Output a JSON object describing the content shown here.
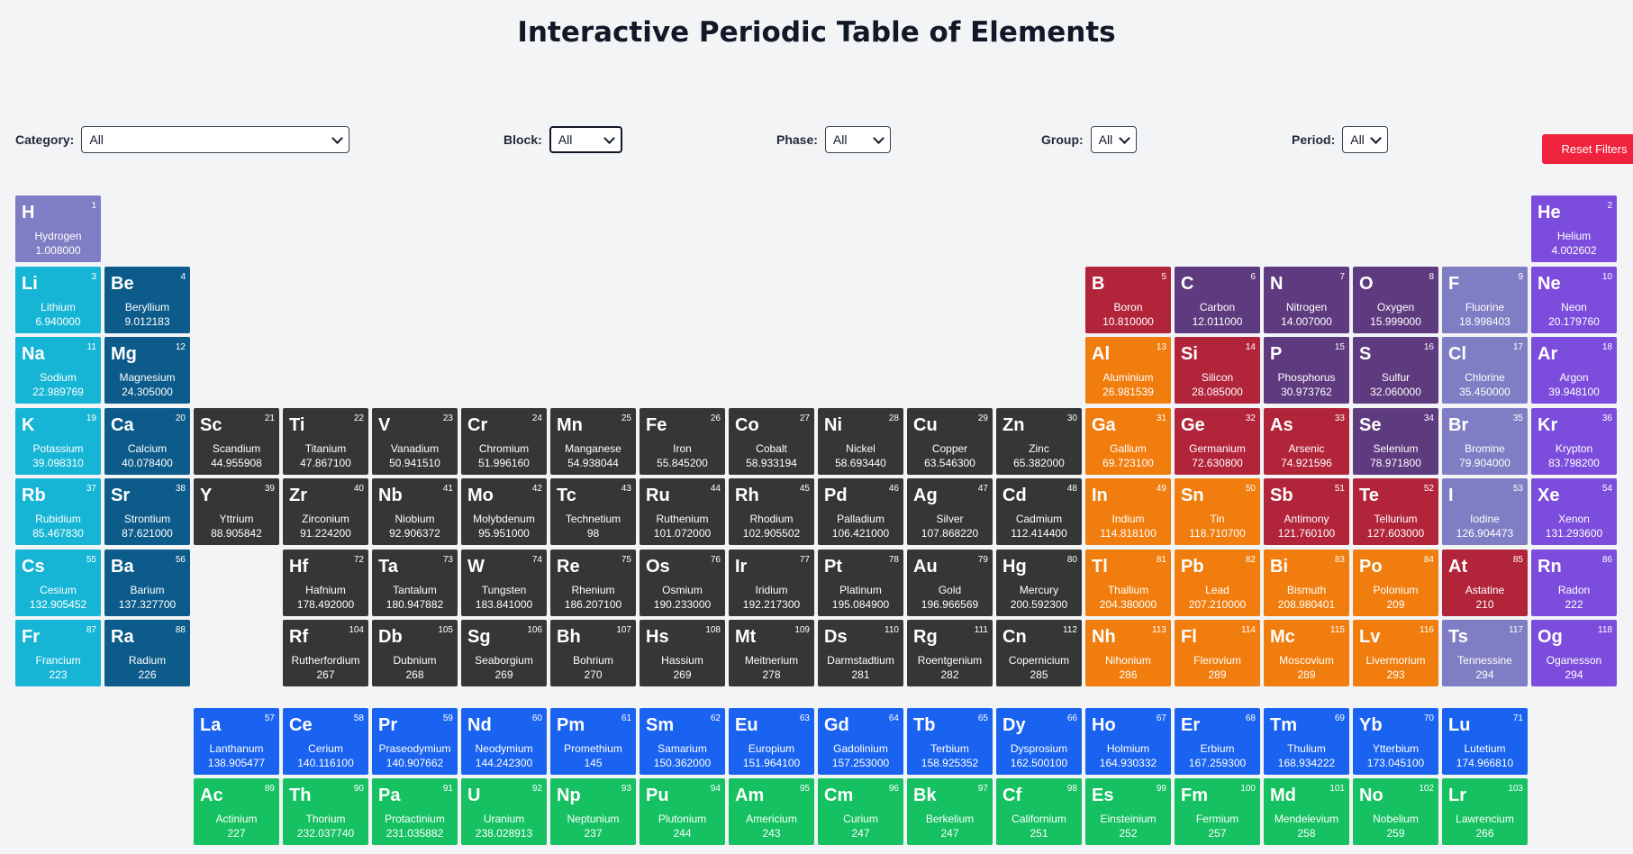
{
  "page_title": "Interactive Periodic Table of Elements",
  "filters": {
    "category": {
      "label": "Category:",
      "value": "All"
    },
    "block": {
      "label": "Block:",
      "value": "All"
    },
    "phase": {
      "label": "Phase:",
      "value": "All"
    },
    "group": {
      "label": "Group:",
      "value": "All"
    },
    "period": {
      "label": "Period:",
      "value": "All"
    },
    "reset_label": "Reset Filters"
  },
  "colors": {
    "nonmetal": "#5e3a7e",
    "noble-gas": "#7c4ddc",
    "alkali-metal": "#16b5d6",
    "alkaline-earth": "#0c5b8a",
    "metalloid": "#b2243a",
    "halogen": "#7f7ec4",
    "transition-metal": "#353638",
    "post-transition": "#f07d0d",
    "lanthanide": "#1a62f0",
    "actinide": "#15c160",
    "reset": "#ef233c"
  },
  "elements": [
    {
      "n": 1,
      "s": "H",
      "name": "Hydrogen",
      "mass": "1.008000",
      "cat": "halogen",
      "p": 1,
      "g": 1
    },
    {
      "n": 2,
      "s": "He",
      "name": "Helium",
      "mass": "4.002602",
      "cat": "noble-gas",
      "p": 1,
      "g": 18
    },
    {
      "n": 3,
      "s": "Li",
      "name": "Lithium",
      "mass": "6.940000",
      "cat": "alkali-metal",
      "p": 2,
      "g": 1
    },
    {
      "n": 4,
      "s": "Be",
      "name": "Beryllium",
      "mass": "9.012183",
      "cat": "alkaline-earth",
      "p": 2,
      "g": 2
    },
    {
      "n": 5,
      "s": "B",
      "name": "Boron",
      "mass": "10.810000",
      "cat": "metalloid",
      "p": 2,
      "g": 13
    },
    {
      "n": 6,
      "s": "C",
      "name": "Carbon",
      "mass": "12.011000",
      "cat": "nonmetal",
      "p": 2,
      "g": 14
    },
    {
      "n": 7,
      "s": "N",
      "name": "Nitrogen",
      "mass": "14.007000",
      "cat": "nonmetal",
      "p": 2,
      "g": 15
    },
    {
      "n": 8,
      "s": "O",
      "name": "Oxygen",
      "mass": "15.999000",
      "cat": "nonmetal",
      "p": 2,
      "g": 16
    },
    {
      "n": 9,
      "s": "F",
      "name": "Fluorine",
      "mass": "18.998403",
      "cat": "halogen",
      "p": 2,
      "g": 17
    },
    {
      "n": 10,
      "s": "Ne",
      "name": "Neon",
      "mass": "20.179760",
      "cat": "noble-gas",
      "p": 2,
      "g": 18
    },
    {
      "n": 11,
      "s": "Na",
      "name": "Sodium",
      "mass": "22.989769",
      "cat": "alkali-metal",
      "p": 3,
      "g": 1
    },
    {
      "n": 12,
      "s": "Mg",
      "name": "Magnesium",
      "mass": "24.305000",
      "cat": "alkaline-earth",
      "p": 3,
      "g": 2
    },
    {
      "n": 13,
      "s": "Al",
      "name": "Aluminium",
      "mass": "26.981539",
      "cat": "post-transition",
      "p": 3,
      "g": 13
    },
    {
      "n": 14,
      "s": "Si",
      "name": "Silicon",
      "mass": "28.085000",
      "cat": "metalloid",
      "p": 3,
      "g": 14
    },
    {
      "n": 15,
      "s": "P",
      "name": "Phosphorus",
      "mass": "30.973762",
      "cat": "nonmetal",
      "p": 3,
      "g": 15
    },
    {
      "n": 16,
      "s": "S",
      "name": "Sulfur",
      "mass": "32.060000",
      "cat": "nonmetal",
      "p": 3,
      "g": 16
    },
    {
      "n": 17,
      "s": "Cl",
      "name": "Chlorine",
      "mass": "35.450000",
      "cat": "halogen",
      "p": 3,
      "g": 17
    },
    {
      "n": 18,
      "s": "Ar",
      "name": "Argon",
      "mass": "39.948100",
      "cat": "noble-gas",
      "p": 3,
      "g": 18
    },
    {
      "n": 19,
      "s": "K",
      "name": "Potassium",
      "mass": "39.098310",
      "cat": "alkali-metal",
      "p": 4,
      "g": 1
    },
    {
      "n": 20,
      "s": "Ca",
      "name": "Calcium",
      "mass": "40.078400",
      "cat": "alkaline-earth",
      "p": 4,
      "g": 2
    },
    {
      "n": 21,
      "s": "Sc",
      "name": "Scandium",
      "mass": "44.955908",
      "cat": "transition-metal",
      "p": 4,
      "g": 3
    },
    {
      "n": 22,
      "s": "Ti",
      "name": "Titanium",
      "mass": "47.867100",
      "cat": "transition-metal",
      "p": 4,
      "g": 4
    },
    {
      "n": 23,
      "s": "V",
      "name": "Vanadium",
      "mass": "50.941510",
      "cat": "transition-metal",
      "p": 4,
      "g": 5
    },
    {
      "n": 24,
      "s": "Cr",
      "name": "Chromium",
      "mass": "51.996160",
      "cat": "transition-metal",
      "p": 4,
      "g": 6
    },
    {
      "n": 25,
      "s": "Mn",
      "name": "Manganese",
      "mass": "54.938044",
      "cat": "transition-metal",
      "p": 4,
      "g": 7
    },
    {
      "n": 26,
      "s": "Fe",
      "name": "Iron",
      "mass": "55.845200",
      "cat": "transition-metal",
      "p": 4,
      "g": 8
    },
    {
      "n": 27,
      "s": "Co",
      "name": "Cobalt",
      "mass": "58.933194",
      "cat": "transition-metal",
      "p": 4,
      "g": 9
    },
    {
      "n": 28,
      "s": "Ni",
      "name": "Nickel",
      "mass": "58.693440",
      "cat": "transition-metal",
      "p": 4,
      "g": 10
    },
    {
      "n": 29,
      "s": "Cu",
      "name": "Copper",
      "mass": "63.546300",
      "cat": "transition-metal",
      "p": 4,
      "g": 11
    },
    {
      "n": 30,
      "s": "Zn",
      "name": "Zinc",
      "mass": "65.382000",
      "cat": "transition-metal",
      "p": 4,
      "g": 12
    },
    {
      "n": 31,
      "s": "Ga",
      "name": "Gallium",
      "mass": "69.723100",
      "cat": "post-transition",
      "p": 4,
      "g": 13
    },
    {
      "n": 32,
      "s": "Ge",
      "name": "Germanium",
      "mass": "72.630800",
      "cat": "metalloid",
      "p": 4,
      "g": 14
    },
    {
      "n": 33,
      "s": "As",
      "name": "Arsenic",
      "mass": "74.921596",
      "cat": "metalloid",
      "p": 4,
      "g": 15
    },
    {
      "n": 34,
      "s": "Se",
      "name": "Selenium",
      "mass": "78.971800",
      "cat": "nonmetal",
      "p": 4,
      "g": 16
    },
    {
      "n": 35,
      "s": "Br",
      "name": "Bromine",
      "mass": "79.904000",
      "cat": "halogen",
      "p": 4,
      "g": 17
    },
    {
      "n": 36,
      "s": "Kr",
      "name": "Krypton",
      "mass": "83.798200",
      "cat": "noble-gas",
      "p": 4,
      "g": 18
    },
    {
      "n": 37,
      "s": "Rb",
      "name": "Rubidium",
      "mass": "85.467830",
      "cat": "alkali-metal",
      "p": 5,
      "g": 1
    },
    {
      "n": 38,
      "s": "Sr",
      "name": "Strontium",
      "mass": "87.621000",
      "cat": "alkaline-earth",
      "p": 5,
      "g": 2
    },
    {
      "n": 39,
      "s": "Y",
      "name": "Yttrium",
      "mass": "88.905842",
      "cat": "transition-metal",
      "p": 5,
      "g": 3
    },
    {
      "n": 40,
      "s": "Zr",
      "name": "Zirconium",
      "mass": "91.224200",
      "cat": "transition-metal",
      "p": 5,
      "g": 4
    },
    {
      "n": 41,
      "s": "Nb",
      "name": "Niobium",
      "mass": "92.906372",
      "cat": "transition-metal",
      "p": 5,
      "g": 5
    },
    {
      "n": 42,
      "s": "Mo",
      "name": "Molybdenum",
      "mass": "95.951000",
      "cat": "transition-metal",
      "p": 5,
      "g": 6
    },
    {
      "n": 43,
      "s": "Tc",
      "name": "Technetium",
      "mass": "98",
      "cat": "transition-metal",
      "p": 5,
      "g": 7
    },
    {
      "n": 44,
      "s": "Ru",
      "name": "Ruthenium",
      "mass": "101.072000",
      "cat": "transition-metal",
      "p": 5,
      "g": 8
    },
    {
      "n": 45,
      "s": "Rh",
      "name": "Rhodium",
      "mass": "102.905502",
      "cat": "transition-metal",
      "p": 5,
      "g": 9
    },
    {
      "n": 46,
      "s": "Pd",
      "name": "Palladium",
      "mass": "106.421000",
      "cat": "transition-metal",
      "p": 5,
      "g": 10
    },
    {
      "n": 47,
      "s": "Ag",
      "name": "Silver",
      "mass": "107.868220",
      "cat": "transition-metal",
      "p": 5,
      "g": 11
    },
    {
      "n": 48,
      "s": "Cd",
      "name": "Cadmium",
      "mass": "112.414400",
      "cat": "transition-metal",
      "p": 5,
      "g": 12
    },
    {
      "n": 49,
      "s": "In",
      "name": "Indium",
      "mass": "114.818100",
      "cat": "post-transition",
      "p": 5,
      "g": 13
    },
    {
      "n": 50,
      "s": "Sn",
      "name": "Tin",
      "mass": "118.710700",
      "cat": "post-transition",
      "p": 5,
      "g": 14
    },
    {
      "n": 51,
      "s": "Sb",
      "name": "Antimony",
      "mass": "121.760100",
      "cat": "metalloid",
      "p": 5,
      "g": 15
    },
    {
      "n": 52,
      "s": "Te",
      "name": "Tellurium",
      "mass": "127.603000",
      "cat": "metalloid",
      "p": 5,
      "g": 16
    },
    {
      "n": 53,
      "s": "I",
      "name": "Iodine",
      "mass": "126.904473",
      "cat": "halogen",
      "p": 5,
      "g": 17
    },
    {
      "n": 54,
      "s": "Xe",
      "name": "Xenon",
      "mass": "131.293600",
      "cat": "noble-gas",
      "p": 5,
      "g": 18
    },
    {
      "n": 55,
      "s": "Cs",
      "name": "Cesium",
      "mass": "132.905452",
      "cat": "alkali-metal",
      "p": 6,
      "g": 1
    },
    {
      "n": 56,
      "s": "Ba",
      "name": "Barium",
      "mass": "137.327700",
      "cat": "alkaline-earth",
      "p": 6,
      "g": 2
    },
    {
      "n": 72,
      "s": "Hf",
      "name": "Hafnium",
      "mass": "178.492000",
      "cat": "transition-metal",
      "p": 6,
      "g": 4
    },
    {
      "n": 73,
      "s": "Ta",
      "name": "Tantalum",
      "mass": "180.947882",
      "cat": "transition-metal",
      "p": 6,
      "g": 5
    },
    {
      "n": 74,
      "s": "W",
      "name": "Tungsten",
      "mass": "183.841000",
      "cat": "transition-metal",
      "p": 6,
      "g": 6
    },
    {
      "n": 75,
      "s": "Re",
      "name": "Rhenium",
      "mass": "186.207100",
      "cat": "transition-metal",
      "p": 6,
      "g": 7
    },
    {
      "n": 76,
      "s": "Os",
      "name": "Osmium",
      "mass": "190.233000",
      "cat": "transition-metal",
      "p": 6,
      "g": 8
    },
    {
      "n": 77,
      "s": "Ir",
      "name": "Iridium",
      "mass": "192.217300",
      "cat": "transition-metal",
      "p": 6,
      "g": 9
    },
    {
      "n": 78,
      "s": "Pt",
      "name": "Platinum",
      "mass": "195.084900",
      "cat": "transition-metal",
      "p": 6,
      "g": 10
    },
    {
      "n": 79,
      "s": "Au",
      "name": "Gold",
      "mass": "196.966569",
      "cat": "transition-metal",
      "p": 6,
      "g": 11
    },
    {
      "n": 80,
      "s": "Hg",
      "name": "Mercury",
      "mass": "200.592300",
      "cat": "transition-metal",
      "p": 6,
      "g": 12
    },
    {
      "n": 81,
      "s": "Tl",
      "name": "Thallium",
      "mass": "204.380000",
      "cat": "post-transition",
      "p": 6,
      "g": 13
    },
    {
      "n": 82,
      "s": "Pb",
      "name": "Lead",
      "mass": "207.210000",
      "cat": "post-transition",
      "p": 6,
      "g": 14
    },
    {
      "n": 83,
      "s": "Bi",
      "name": "Bismuth",
      "mass": "208.980401",
      "cat": "post-transition",
      "p": 6,
      "g": 15
    },
    {
      "n": 84,
      "s": "Po",
      "name": "Polonium",
      "mass": "209",
      "cat": "post-transition",
      "p": 6,
      "g": 16
    },
    {
      "n": 85,
      "s": "At",
      "name": "Astatine",
      "mass": "210",
      "cat": "metalloid",
      "p": 6,
      "g": 17
    },
    {
      "n": 86,
      "s": "Rn",
      "name": "Radon",
      "mass": "222",
      "cat": "noble-gas",
      "p": 6,
      "g": 18
    },
    {
      "n": 87,
      "s": "Fr",
      "name": "Francium",
      "mass": "223",
      "cat": "alkali-metal",
      "p": 7,
      "g": 1
    },
    {
      "n": 88,
      "s": "Ra",
      "name": "Radium",
      "mass": "226",
      "cat": "alkaline-earth",
      "p": 7,
      "g": 2
    },
    {
      "n": 104,
      "s": "Rf",
      "name": "Rutherfordium",
      "mass": "267",
      "cat": "transition-metal",
      "p": 7,
      "g": 4
    },
    {
      "n": 105,
      "s": "Db",
      "name": "Dubnium",
      "mass": "268",
      "cat": "transition-metal",
      "p": 7,
      "g": 5
    },
    {
      "n": 106,
      "s": "Sg",
      "name": "Seaborgium",
      "mass": "269",
      "cat": "transition-metal",
      "p": 7,
      "g": 6
    },
    {
      "n": 107,
      "s": "Bh",
      "name": "Bohrium",
      "mass": "270",
      "cat": "transition-metal",
      "p": 7,
      "g": 7
    },
    {
      "n": 108,
      "s": "Hs",
      "name": "Hassium",
      "mass": "269",
      "cat": "transition-metal",
      "p": 7,
      "g": 8
    },
    {
      "n": 109,
      "s": "Mt",
      "name": "Meitnerium",
      "mass": "278",
      "cat": "transition-metal",
      "p": 7,
      "g": 9
    },
    {
      "n": 110,
      "s": "Ds",
      "name": "Darmstadtium",
      "mass": "281",
      "cat": "transition-metal",
      "p": 7,
      "g": 10
    },
    {
      "n": 111,
      "s": "Rg",
      "name": "Roentgenium",
      "mass": "282",
      "cat": "transition-metal",
      "p": 7,
      "g": 11
    },
    {
      "n": 112,
      "s": "Cn",
      "name": "Copernicium",
      "mass": "285",
      "cat": "transition-metal",
      "p": 7,
      "g": 12
    },
    {
      "n": 113,
      "s": "Nh",
      "name": "Nihonium",
      "mass": "286",
      "cat": "post-transition",
      "p": 7,
      "g": 13
    },
    {
      "n": 114,
      "s": "Fl",
      "name": "Flerovium",
      "mass": "289",
      "cat": "post-transition",
      "p": 7,
      "g": 14
    },
    {
      "n": 115,
      "s": "Mc",
      "name": "Moscovium",
      "mass": "289",
      "cat": "post-transition",
      "p": 7,
      "g": 15
    },
    {
      "n": 116,
      "s": "Lv",
      "name": "Livermorium",
      "mass": "293",
      "cat": "post-transition",
      "p": 7,
      "g": 16
    },
    {
      "n": 117,
      "s": "Ts",
      "name": "Tennessine",
      "mass": "294",
      "cat": "halogen",
      "p": 7,
      "g": 17
    },
    {
      "n": 118,
      "s": "Og",
      "name": "Oganesson",
      "mass": "294",
      "cat": "noble-gas",
      "p": 7,
      "g": 18
    },
    {
      "n": 57,
      "s": "La",
      "name": "Lanthanum",
      "mass": "138.905477",
      "cat": "lanthanide",
      "p": 6,
      "g": "La"
    },
    {
      "n": 58,
      "s": "Ce",
      "name": "Cerium",
      "mass": "140.116100",
      "cat": "lanthanide",
      "p": 6,
      "g": "La"
    },
    {
      "n": 59,
      "s": "Pr",
      "name": "Praseodymium",
      "mass": "140.907662",
      "cat": "lanthanide",
      "p": 6,
      "g": "La"
    },
    {
      "n": 60,
      "s": "Nd",
      "name": "Neodymium",
      "mass": "144.242300",
      "cat": "lanthanide",
      "p": 6,
      "g": "La"
    },
    {
      "n": 61,
      "s": "Pm",
      "name": "Promethium",
      "mass": "145",
      "cat": "lanthanide",
      "p": 6,
      "g": "La"
    },
    {
      "n": 62,
      "s": "Sm",
      "name": "Samarium",
      "mass": "150.362000",
      "cat": "lanthanide",
      "p": 6,
      "g": "La"
    },
    {
      "n": 63,
      "s": "Eu",
      "name": "Europium",
      "mass": "151.964100",
      "cat": "lanthanide",
      "p": 6,
      "g": "La"
    },
    {
      "n": 64,
      "s": "Gd",
      "name": "Gadolinium",
      "mass": "157.253000",
      "cat": "lanthanide",
      "p": 6,
      "g": "La"
    },
    {
      "n": 65,
      "s": "Tb",
      "name": "Terbium",
      "mass": "158.925352",
      "cat": "lanthanide",
      "p": 6,
      "g": "La"
    },
    {
      "n": 66,
      "s": "Dy",
      "name": "Dysprosium",
      "mass": "162.500100",
      "cat": "lanthanide",
      "p": 6,
      "g": "La"
    },
    {
      "n": 67,
      "s": "Ho",
      "name": "Holmium",
      "mass": "164.930332",
      "cat": "lanthanide",
      "p": 6,
      "g": "La"
    },
    {
      "n": 68,
      "s": "Er",
      "name": "Erbium",
      "mass": "167.259300",
      "cat": "lanthanide",
      "p": 6,
      "g": "La"
    },
    {
      "n": 69,
      "s": "Tm",
      "name": "Thulium",
      "mass": "168.934222",
      "cat": "lanthanide",
      "p": 6,
      "g": "La"
    },
    {
      "n": 70,
      "s": "Yb",
      "name": "Ytterbium",
      "mass": "173.045100",
      "cat": "lanthanide",
      "p": 6,
      "g": "La"
    },
    {
      "n": 71,
      "s": "Lu",
      "name": "Lutetium",
      "mass": "174.966810",
      "cat": "lanthanide",
      "p": 6,
      "g": "La"
    },
    {
      "n": 89,
      "s": "Ac",
      "name": "Actinium",
      "mass": "227",
      "cat": "actinide",
      "p": 7,
      "g": "Ac"
    },
    {
      "n": 90,
      "s": "Th",
      "name": "Thorium",
      "mass": "232.037740",
      "cat": "actinide",
      "p": 7,
      "g": "Ac"
    },
    {
      "n": 91,
      "s": "Pa",
      "name": "Protactinium",
      "mass": "231.035882",
      "cat": "actinide",
      "p": 7,
      "g": "Ac"
    },
    {
      "n": 92,
      "s": "U",
      "name": "Uranium",
      "mass": "238.028913",
      "cat": "actinide",
      "p": 7,
      "g": "Ac"
    },
    {
      "n": 93,
      "s": "Np",
      "name": "Neptunium",
      "mass": "237",
      "cat": "actinide",
      "p": 7,
      "g": "Ac"
    },
    {
      "n": 94,
      "s": "Pu",
      "name": "Plutonium",
      "mass": "244",
      "cat": "actinide",
      "p": 7,
      "g": "Ac"
    },
    {
      "n": 95,
      "s": "Am",
      "name": "Americium",
      "mass": "243",
      "cat": "actinide",
      "p": 7,
      "g": "Ac"
    },
    {
      "n": 96,
      "s": "Cm",
      "name": "Curium",
      "mass": "247",
      "cat": "actinide",
      "p": 7,
      "g": "Ac"
    },
    {
      "n": 97,
      "s": "Bk",
      "name": "Berkelium",
      "mass": "247",
      "cat": "actinide",
      "p": 7,
      "g": "Ac"
    },
    {
      "n": 98,
      "s": "Cf",
      "name": "Californium",
      "mass": "251",
      "cat": "actinide",
      "p": 7,
      "g": "Ac"
    },
    {
      "n": 99,
      "s": "Es",
      "name": "Einsteinium",
      "mass": "252",
      "cat": "actinide",
      "p": 7,
      "g": "Ac"
    },
    {
      "n": 100,
      "s": "Fm",
      "name": "Fermium",
      "mass": "257",
      "cat": "actinide",
      "p": 7,
      "g": "Ac"
    },
    {
      "n": 101,
      "s": "Md",
      "name": "Mendelevium",
      "mass": "258",
      "cat": "actinide",
      "p": 7,
      "g": "Ac"
    },
    {
      "n": 102,
      "s": "No",
      "name": "Nobelium",
      "mass": "259",
      "cat": "actinide",
      "p": 7,
      "g": "Ac"
    },
    {
      "n": 103,
      "s": "Lr",
      "name": "Lawrencium",
      "mass": "266",
      "cat": "actinide",
      "p": 7,
      "g": "Ac"
    }
  ]
}
